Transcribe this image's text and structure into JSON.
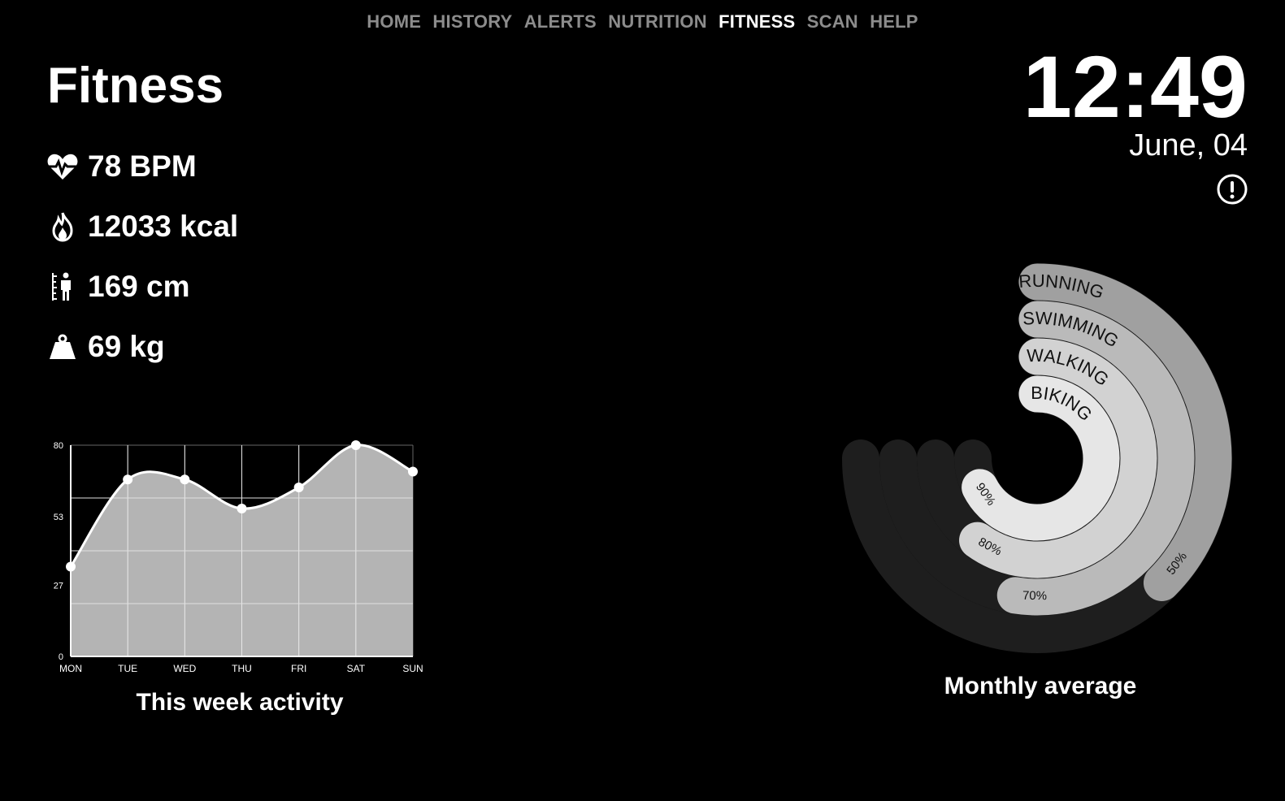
{
  "nav": {
    "items": [
      "HOME",
      "HISTORY",
      "ALERTS",
      "NUTRITION",
      "FITNESS",
      "SCAN",
      "HELP"
    ],
    "active": "FITNESS"
  },
  "page": {
    "title": "Fitness"
  },
  "stats": {
    "heart_rate": "78 BPM",
    "calories": "12033 kcal",
    "height": "169 cm",
    "weight": "69 kg"
  },
  "clock": {
    "time": "12:49",
    "date": "June, 04"
  },
  "weekly_chart_title": "This week activity",
  "monthly_chart_title": "Monthly average",
  "colors": {
    "background": "#000000",
    "nav_inactive": "#8c8c8c",
    "chart_fill": "#c8c8c8",
    "ring_track": "#1e1e1e"
  },
  "chart_data": [
    {
      "type": "area",
      "title": "This week activity",
      "categories": [
        "MON",
        "TUE",
        "WED",
        "THU",
        "FRI",
        "SAT",
        "SUN"
      ],
      "values": [
        34,
        67,
        67,
        56,
        64,
        80,
        70
      ],
      "yticks": [
        0,
        27,
        53,
        80
      ],
      "ylim": [
        0,
        80
      ],
      "grid": true,
      "smooth": true
    },
    {
      "type": "radial-bar",
      "title": "Monthly average",
      "series": [
        {
          "name": "RUNNING",
          "value": 50,
          "label": "50%",
          "color": "#a0a0a0"
        },
        {
          "name": "SWIMMING",
          "value": 70,
          "label": "70%",
          "color": "#bababa"
        },
        {
          "name": "WALKING",
          "value": 80,
          "label": "80%",
          "color": "#d2d2d2"
        },
        {
          "name": "BIKING",
          "value": 90,
          "label": "90%",
          "color": "#e6e6e6"
        }
      ],
      "max": 100
    }
  ]
}
